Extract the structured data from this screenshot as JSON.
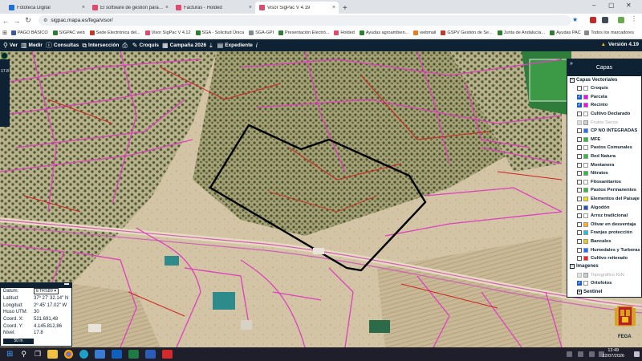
{
  "browser": {
    "tabs": [
      {
        "label": "Fototeca Digital",
        "favicon_color": "#1e6fd9",
        "active": false
      },
      {
        "label": "El software de gestión para py...",
        "favicon_color": "#e04a6d",
        "active": false
      },
      {
        "label": "Facturas - Holded",
        "favicon_color": "#e04a6d",
        "active": false
      },
      {
        "label": "Visor SigPac V 4.19",
        "favicon_color": "#e04a6d",
        "active": true
      }
    ],
    "new_tab": "+",
    "url": "sigpac.mapa.es/fega/visor/",
    "bookmarks": [
      {
        "label": "PAGO BÁSICO",
        "color": "#3b5998"
      },
      {
        "label": "SIGPAC web",
        "color": "#2d7d32"
      },
      {
        "label": "Sede Electrónica del...",
        "color": "#c0392b"
      },
      {
        "label": "Visor SigPac V 4.12",
        "color": "#e04a6d"
      },
      {
        "label": "SGA - Solicitud Única",
        "color": "#2d7d32"
      },
      {
        "label": "SGA-GPI",
        "color": "#7f8c8d"
      },
      {
        "label": "Presentación Electró...",
        "color": "#2d7d32"
      },
      {
        "label": "Holded",
        "color": "#e04a6d"
      },
      {
        "label": "Ayudas agroambien...",
        "color": "#2d7d32"
      },
      {
        "label": "webmail",
        "color": "#e67e22"
      },
      {
        "label": "GSPV Gestión de Se...",
        "color": "#c0392b"
      },
      {
        "label": "Junta de Andalucía...",
        "color": "#2d7d32"
      },
      {
        "label": "Ayudas PAC",
        "color": "#2d7d32"
      }
    ],
    "all_bookmarks": "Todos los marcadores"
  },
  "toolbar": {
    "items": [
      {
        "label": "Ver",
        "icon": "search-icon",
        "glyph": "⚲"
      },
      {
        "label": "Medir",
        "icon": "ruler-icon",
        "glyph": "▥"
      },
      {
        "label": "Consultas",
        "icon": "info-icon",
        "glyph": "ⓘ"
      },
      {
        "label": "Intersección",
        "icon": "intersection-icon",
        "glyph": "⧉"
      },
      {
        "label": "",
        "icon": "print-icon",
        "glyph": "⎙"
      },
      {
        "label": "Croquis",
        "icon": "pencil-icon",
        "glyph": "✎"
      },
      {
        "label": "Campaña 2026",
        "icon": "calendar-icon",
        "glyph": "▦"
      },
      {
        "label": "",
        "icon": "download-icon",
        "glyph": "⤓"
      },
      {
        "label": "Expediente",
        "icon": "document-icon",
        "glyph": "▤"
      },
      {
        "label": "",
        "icon": "help-icon",
        "glyph": "i"
      }
    ],
    "version": "Versión 4.19"
  },
  "map": {
    "zoom_readout": "17.8"
  },
  "layers_panel": {
    "title": "Capas",
    "vector_group": "Capas Vectoriales",
    "vector_layers": [
      {
        "label": "Croquis",
        "checked": false,
        "swatch": "#ffffff",
        "dimmed": false
      },
      {
        "label": "Parcela",
        "checked": true,
        "swatch": "#ff00ff",
        "dimmed": false
      },
      {
        "label": "Recinto",
        "checked": true,
        "swatch": "#ff00ff",
        "dimmed": false
      },
      {
        "label": "Cultivo Declarado",
        "checked": false,
        "swatch": "#ffffff",
        "dimmed": false
      },
      {
        "label": "Frutos Secos",
        "checked": false,
        "swatch": "#cfcfcf",
        "dimmed": true
      },
      {
        "label": "CP NO INTEGRADAS",
        "checked": false,
        "swatch": "#1f6fff",
        "dimmed": false
      },
      {
        "label": "MFE",
        "checked": false,
        "swatch": "#2dbf3a",
        "dimmed": false
      },
      {
        "label": "Pastos Comunales",
        "checked": false,
        "swatch": "#ffffff",
        "dimmed": false
      },
      {
        "label": "Red Natura",
        "checked": false,
        "swatch": "#2dbf3a",
        "dimmed": false
      },
      {
        "label": "Montanera",
        "checked": false,
        "swatch": "#ffffff",
        "dimmed": false
      },
      {
        "label": "Nitratos",
        "checked": false,
        "swatch": "#2dbf3a",
        "dimmed": false
      },
      {
        "label": "Fitosanitarios",
        "checked": false,
        "swatch": "#ffffff",
        "dimmed": false
      },
      {
        "label": "Pastos Permanentes",
        "checked": false,
        "swatch": "#2dbf3a",
        "dimmed": false
      },
      {
        "label": "Elementos del Paisaje",
        "checked": false,
        "swatch": "#f2e600",
        "dimmed": false
      },
      {
        "label": "Algodón",
        "checked": false,
        "swatch": "#1f4fd1",
        "dimmed": false
      },
      {
        "label": "Arroz tradicional",
        "checked": false,
        "swatch": "#ffffff",
        "dimmed": false
      },
      {
        "label": "Olivar en desventaja",
        "checked": false,
        "swatch": "#ffb020",
        "dimmed": false
      },
      {
        "label": "Franjas protección",
        "checked": false,
        "swatch": "#1fc0e0",
        "dimmed": false
      },
      {
        "label": "Bancales",
        "checked": false,
        "swatch": "#e8d000",
        "dimmed": false
      },
      {
        "label": "Humedales y Turberas",
        "checked": false,
        "swatch": "#1f6fff",
        "dimmed": false
      },
      {
        "label": "Cultivo reiterado",
        "checked": false,
        "swatch": "#ff1f1f",
        "dimmed": false
      }
    ],
    "image_group": "Imagenes",
    "image_layers": [
      {
        "label": "Topográfico IGN",
        "checked": true,
        "swatch": "#cfcfcf",
        "dimmed": true
      },
      {
        "label": "Ortofotos",
        "checked": true,
        "swatch": "#ffffff",
        "dimmed": false
      }
    ],
    "sentinel": "Sentinel"
  },
  "coordinates": {
    "datum_label": "Datum:",
    "datum_value": "ETRS89",
    "lat_label": "Latitud:",
    "lat_value": "37º 27' 32.14\" N",
    "lon_label": "Longitud:",
    "lon_value": "2º 45' 17.02\" W",
    "huso_label": "Huso UTM:",
    "huso_value": "30",
    "x_label": "Coord. X:",
    "x_value": "521.691,48",
    "y_label": "Coord. Y:",
    "y_value": "4.145.812,86",
    "nivel_label": "Nivel:",
    "nivel_value": "17.8",
    "scale": "50 m"
  },
  "emblem_text": "FEGA",
  "taskbar": {
    "time": "13:49",
    "date": "22/07/2026"
  },
  "colors": {
    "dark_navy": "#0e2233",
    "parcel_magenta": "#e040c0",
    "recinto_red": "#d02020"
  }
}
